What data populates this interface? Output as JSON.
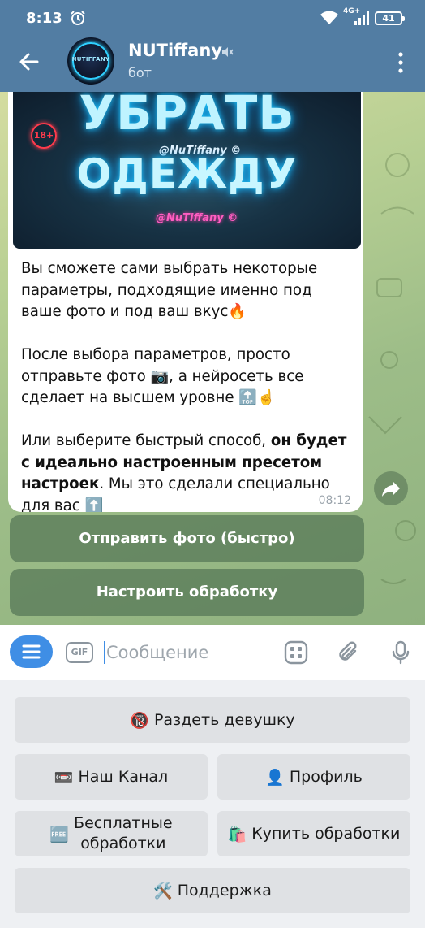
{
  "status_bar": {
    "time": "8:13",
    "battery": "41",
    "network": "4G+"
  },
  "header": {
    "title": "NUTiffany",
    "subtitle": "бот",
    "avatar_text": "NUTIFFANY"
  },
  "message": {
    "banner": {
      "line1": "УБРАТЬ",
      "line2": "ОДЕЖДУ",
      "watermark_top": "@NuTiffany ©",
      "watermark_bottom": "@NuTiffany ©",
      "age_badge": "18+"
    },
    "paragraph1": "Вы сможете сами выбрать некоторые параметры, подходящие именно под ваше фото и под ваш вкус🔥",
    "paragraph2": "После выбора параметров, просто отправьте фото 📷, а нейросеть все сделает на высшем уровне 🔝☝️",
    "paragraph3_pre": "Или выберите быстрый способ, ",
    "paragraph3_bold": "он будет с идеально настроенным пресетом настроек",
    "paragraph3_post": ". Мы это сделали специально для вас ⬆️",
    "time": "08:12"
  },
  "inline_buttons": [
    {
      "label": "Отправить фото (быстро)"
    },
    {
      "label": "Настроить обработку"
    }
  ],
  "input": {
    "placeholder": "Сообщение",
    "gif_label": "GIF"
  },
  "keyboard": {
    "undress": {
      "emoji": "🔞",
      "label": "Раздеть девушку"
    },
    "channel": {
      "emoji": "📼",
      "label": "Наш Канал"
    },
    "profile": {
      "emoji": "👤",
      "label": "Профиль"
    },
    "free": {
      "emoji": "🆓",
      "label1": "Бесплатные",
      "label2": "обработки"
    },
    "buy": {
      "emoji": "🛍️",
      "label": "Купить обработки"
    },
    "support": {
      "emoji": "🛠️",
      "label": "Поддержка"
    }
  },
  "colors": {
    "header": "#527da3",
    "accent": "#3f8ee5",
    "inline_button": "#547656",
    "keyboard_button": "#dfe1e4"
  }
}
